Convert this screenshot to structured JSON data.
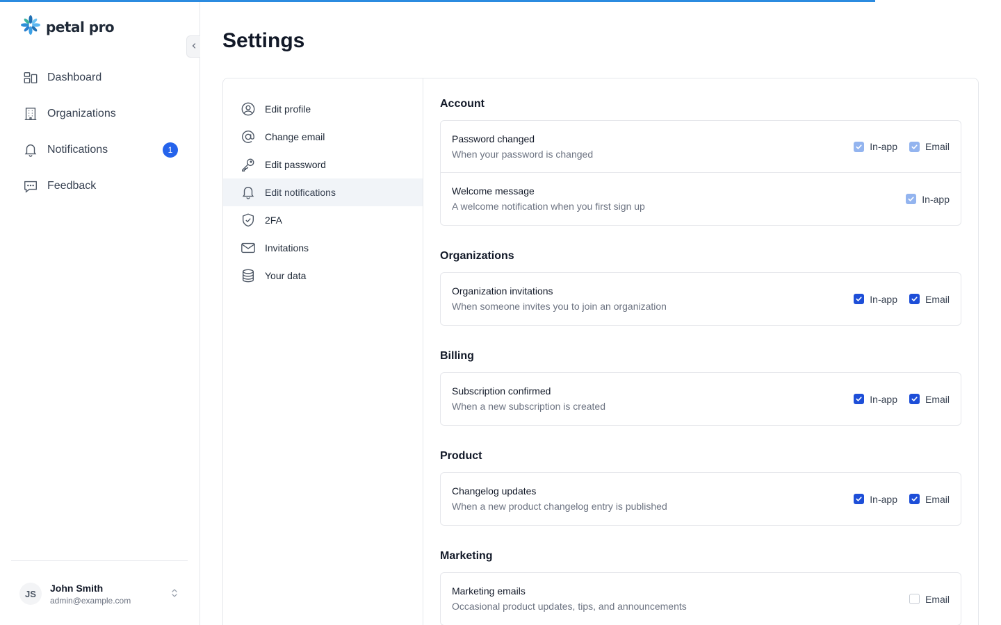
{
  "app": {
    "logo_text": "petal pro"
  },
  "sidebar": {
    "items": [
      {
        "label": "Dashboard",
        "icon": "dashboard-icon"
      },
      {
        "label": "Organizations",
        "icon": "building-icon"
      },
      {
        "label": "Notifications",
        "icon": "bell-icon",
        "badge": "1"
      },
      {
        "label": "Feedback",
        "icon": "chat-icon"
      }
    ],
    "user": {
      "initials": "JS",
      "name": "John Smith",
      "email": "admin@example.com"
    }
  },
  "page": {
    "title": "Settings"
  },
  "settings_nav": [
    {
      "label": "Edit profile",
      "icon": "user-circle-icon"
    },
    {
      "label": "Change email",
      "icon": "at-sign-icon"
    },
    {
      "label": "Edit password",
      "icon": "key-icon"
    },
    {
      "label": "Edit notifications",
      "icon": "bell-icon",
      "active": true
    },
    {
      "label": "2FA",
      "icon": "shield-check-icon"
    },
    {
      "label": "Invitations",
      "icon": "envelope-icon"
    },
    {
      "label": "Your data",
      "icon": "database-icon"
    }
  ],
  "sections": [
    {
      "title": "Account",
      "rows": [
        {
          "title": "Password changed",
          "desc": "When your password is changed",
          "options": [
            {
              "label": "In-app",
              "state": "disabled"
            },
            {
              "label": "Email",
              "state": "disabled"
            }
          ]
        },
        {
          "title": "Welcome message",
          "desc": "A welcome notification when you first sign up",
          "options": [
            {
              "label": "In-app",
              "state": "disabled"
            }
          ]
        }
      ]
    },
    {
      "title": "Organizations",
      "rows": [
        {
          "title": "Organization invitations",
          "desc": "When someone invites you to join an organization",
          "options": [
            {
              "label": "In-app",
              "state": "checked"
            },
            {
              "label": "Email",
              "state": "checked"
            }
          ]
        }
      ]
    },
    {
      "title": "Billing",
      "rows": [
        {
          "title": "Subscription confirmed",
          "desc": "When a new subscription is created",
          "options": [
            {
              "label": "In-app",
              "state": "checked"
            },
            {
              "label": "Email",
              "state": "checked"
            }
          ]
        }
      ]
    },
    {
      "title": "Product",
      "rows": [
        {
          "title": "Changelog updates",
          "desc": "When a new product changelog entry is published",
          "options": [
            {
              "label": "In-app",
              "state": "checked"
            },
            {
              "label": "Email",
              "state": "checked"
            }
          ]
        }
      ]
    },
    {
      "title": "Marketing",
      "rows": [
        {
          "title": "Marketing emails",
          "desc": "Occasional product updates, tips, and announcements",
          "options": [
            {
              "label": "Email",
              "state": "unchecked"
            }
          ]
        }
      ]
    }
  ],
  "colors": {
    "accent": "#1d4ed8",
    "progress": "#2b8be0",
    "badge": "#2563eb"
  }
}
